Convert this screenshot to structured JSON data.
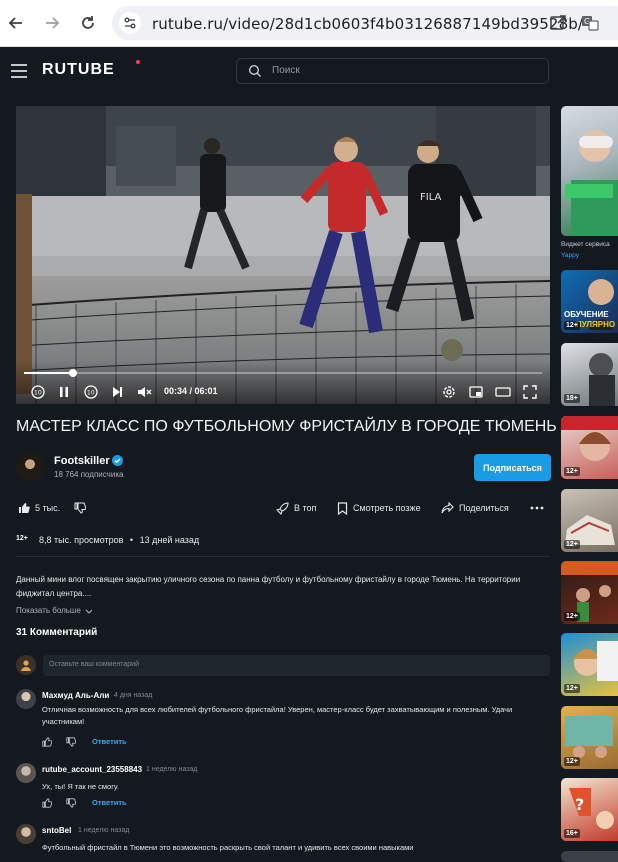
{
  "browser": {
    "url": "rutube.ru/video/28d1cb0603f4b03126887149bd39528b/"
  },
  "header": {
    "logo": "RUTUBE",
    "search_placeholder": "Поиск"
  },
  "player": {
    "current_time": "00:34",
    "duration": "06:01",
    "time_display": "00:34 / 06:01",
    "progress_fraction": 0.094
  },
  "video": {
    "title": "МАСТЕР КЛАСС ПО ФУТБОЛЬНОМУ ФРИСТАЙЛУ В ГОРОДЕ ТЮМЕНЬ",
    "channel_name": "Footskiller",
    "subscribers": "18 764 подписчика",
    "subscribe_label": "Подписаться",
    "likes": "5 тыс.",
    "top_label": "В топ",
    "watch_later_label": "Смотреть позже",
    "share_label": "Поделиться",
    "age_rating": "12+",
    "views": "8,8 тыс. просмотров",
    "dot": "•",
    "posted": "13 дней назад",
    "description": "Данный мини влог посвящен закрытию уличного сезона по панна футболу и футбольному фристайлу в городе Тюмень. На территории фиджитал центра....",
    "show_more": "Показать больше"
  },
  "comments": {
    "heading": "31 Комментарий",
    "input_placeholder": "Оставьте ваш комментарий",
    "reply_label": "Ответить",
    "items": [
      {
        "author": "Махмуд Аль-Али",
        "date": "4 дня назад",
        "text": "Отличная возможность для всех любителей футбольного фристайла! Уверен, мастер-класс будет захватывающим и полезным. Удачи участникам!"
      },
      {
        "author": "rutube_account_23558843",
        "date": "1 неделю назад",
        "text": "Ух, ты! Я так не смогу."
      },
      {
        "author": "sntoBel",
        "date": "1 неделю назад",
        "text": "Футбольный фристайл в Тюмени это возможность раскрыть свой талант и удивить всех своими навыками"
      }
    ]
  },
  "rail": {
    "widget_caption": "Виджет сервиса",
    "widget_source": "Yappy",
    "badges": [
      "18+",
      "12+",
      "12+",
      "12+",
      "12+",
      "12+",
      "12+",
      "16+"
    ],
    "overlay_text_1": "ОБУЧЕНИЕ",
    "overlay_text_2": "ПУЛЯРНО"
  },
  "colors": {
    "background": "#14191f",
    "accent": "#1a9be6",
    "link": "#38a6ee",
    "logo_dot": "#ff3c5a"
  }
}
